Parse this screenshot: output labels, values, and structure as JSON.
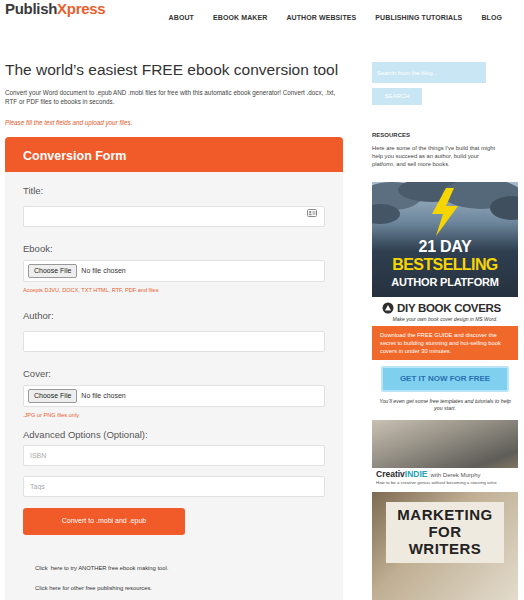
{
  "header": {
    "logo": [
      "Publish",
      "Xpress"
    ],
    "nav": [
      {
        "label": "ABOUT"
      },
      {
        "label": "EBOOK MAKER"
      },
      {
        "label": "AUTHOR WEBSITES"
      },
      {
        "label": "PUBLISHING TUTORIALS"
      },
      {
        "label": "BLOG"
      }
    ]
  },
  "page": {
    "title": "The world’s easiest FREE ebook conversion tool",
    "intro": "Convert your Word document to .epub AND .mobi files for free with this automatic ebook generator! Convert .docx, .txt, RTF or PDF files to ebooks in seconds.",
    "instruction": "Please fill the text fields and upload your files."
  },
  "form": {
    "heading": "Conversion Form",
    "fields": [
      {
        "kind": "text",
        "label": "Title:",
        "icon": true
      },
      {
        "kind": "file",
        "label": "Ebook:",
        "button": "Choose File",
        "status": "No file chosen",
        "hint": "Accepts DJVU, DOCX, TXT HTML, RTF, PDF and files"
      },
      {
        "kind": "text",
        "label": "Author:",
        "icon": false
      },
      {
        "kind": "file",
        "label": "Cover:",
        "button": "Choose File",
        "status": "No file chosen",
        "hint": ".JPG or PNG files only"
      }
    ],
    "advanced_label": "Advanced Options (Optional):",
    "advanced_fields": [
      {
        "placeholder": "ISBN"
      },
      {
        "placeholder": "Tags"
      }
    ],
    "submit": "Convert to .mobi and .epub",
    "links": [
      "Click  here to try ANOTHER free ebook making tool.",
      "Click here for other free publishing resources."
    ]
  },
  "sidebar": {
    "search": {
      "placeholder": "Search from the blog...",
      "button": "SEARCH"
    },
    "resources": {
      "heading": "RESOURCES",
      "text": "Here are some of the things I’ve build that might help you succeed as an author, build your platform, and sell more books."
    },
    "platform_banner": {
      "lines": [
        "21 DAY",
        "BESTSELLING",
        "AUTHOR PLATFORM"
      ]
    },
    "book_covers": {
      "title": "DIY BOOK COVERS",
      "subtitle": "Make your own book cover design in MS Word.",
      "offer": "Download the FREE GUIDE and discover the secret to building stunning and hot-selling book covers in under 30 minutes.",
      "button": "GET IT NOW FOR FREE",
      "note": "You’ll even get some free templates and tutorials to help you start."
    },
    "creativindie": {
      "name": [
        "Creativ",
        "INDIE"
      ],
      "byline": "with Derek Murphy",
      "tagline": "How to be a creative genius without becoming a starving artist"
    },
    "marketing": {
      "lines": [
        "MARKETING",
        "FOR",
        "WRITERS"
      ]
    }
  }
}
